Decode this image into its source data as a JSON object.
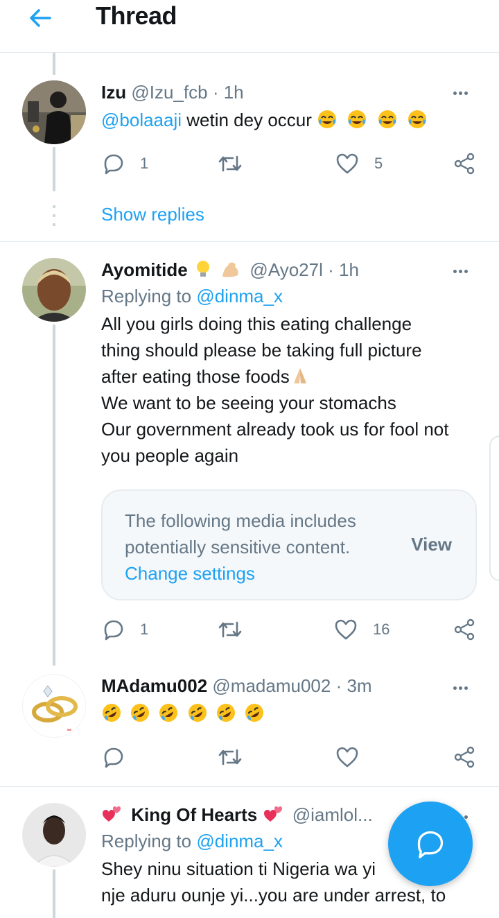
{
  "header": {
    "title": "Thread",
    "back_icon": "arrow-left-icon"
  },
  "colors": {
    "accent": "#1da1f2",
    "muted": "#657786",
    "text": "#14171a",
    "border": "#e1e8ed"
  },
  "tweets": [
    {
      "name": "Izu",
      "handle": "@Izu_fcb",
      "time": "1h",
      "text_mention": "@bolaaaji",
      "text": "wetin dey occur",
      "emojis": [
        "face-with-tears-of-joy",
        "face-with-tears-of-joy",
        "face-with-tears-of-joy",
        "face-with-tears-of-joy"
      ],
      "reply_count": "1",
      "retweet_count": "",
      "like_count": "5"
    },
    {
      "name": "Ayomitide",
      "name_emojis": [
        "light-bulb",
        "flexed-biceps"
      ],
      "handle": "@Ayo27l",
      "time": "1h",
      "replying_label": "Replying to",
      "replying_to": "@dinma_x",
      "lines": [
        "All you girls doing this eating challenge",
        "thing should please be taking full picture",
        "after eating those foods",
        "We want to be seeing your stomachs",
        "Our government already took us for fool not",
        "you people again"
      ],
      "line3_emoji": "folded-hands",
      "sensitive": {
        "line1": "The following media includes",
        "line2": "potentially sensitive content.",
        "link": "Change settings",
        "view": "View"
      },
      "reply_count": "1",
      "retweet_count": "",
      "like_count": "16"
    },
    {
      "name": "MAdamu002",
      "handle": "@madamu002",
      "time": "3m",
      "emojis": [
        "rolling-on-floor-laughing",
        "rolling-on-floor-laughing",
        "rolling-on-floor-laughing",
        "rolling-on-floor-laughing",
        "rolling-on-floor-laughing",
        "rolling-on-floor-laughing"
      ],
      "reply_count": "",
      "retweet_count": "",
      "like_count": ""
    },
    {
      "name": "King Of Hearts",
      "name_emojis": [
        "two-hearts",
        "two-hearts"
      ],
      "handle": "@iamlol...",
      "replying_label": "Replying to",
      "replying_to": "@dinma_x",
      "lines": [
        "Shey ninu situation ti Nigeria wa yi",
        "nje aduru ounje yi...you are under arrest, to"
      ]
    }
  ],
  "show_replies": "Show replies",
  "fab": {
    "icon": "compose-reply-icon"
  }
}
